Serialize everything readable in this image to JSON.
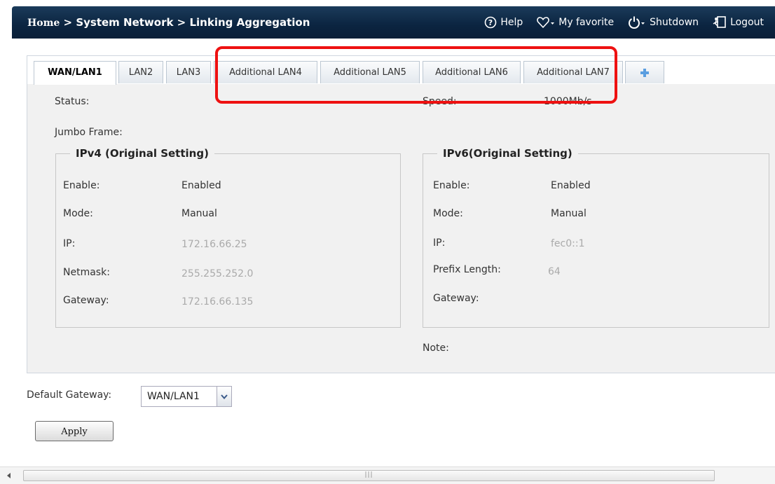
{
  "header": {
    "breadcrumb_home": "Home",
    "breadcrumb_sep1": " > ",
    "breadcrumb_mid": "System Network",
    "breadcrumb_sep2": " > ",
    "breadcrumb_page": "Linking Aggregation",
    "help": "Help",
    "favorite": "My favorite",
    "shutdown": "Shutdown",
    "logout": "Logout"
  },
  "tabs": [
    "WAN/LAN1",
    "LAN2",
    "LAN3",
    "Additional LAN4",
    "Additional LAN5",
    "Additional LAN6",
    "Additional LAN7"
  ],
  "status_label": "Status:",
  "speed_label": "Speed:",
  "speed_value": "1000Mb/s",
  "jumbo_label": "Jumbo Frame:",
  "ipv4": {
    "legend": "IPv4 (Original Setting)",
    "enable_label": "Enable:",
    "enable_value": "Enabled",
    "mode_label": "Mode:",
    "mode_value": "Manual",
    "ip_label": "IP:",
    "ip_value": "172.16.66.25",
    "netmask_label": "Netmask:",
    "netmask_value": "255.255.252.0",
    "gateway_label": "Gateway:",
    "gateway_value": "172.16.66.135"
  },
  "ipv6": {
    "legend": "IPv6(Original Setting)",
    "enable_label": "Enable:",
    "enable_value": "Enabled",
    "mode_label": "Mode:",
    "mode_value": "Manual",
    "ip_label": "IP:",
    "ip_value": "fec0::1",
    "prefix_label": "Prefix Length:",
    "prefix_value": "64",
    "gateway_label": "Gateway:"
  },
  "note_label": "Note:",
  "default_gateway": {
    "label": "Default Gateway:",
    "value": "WAN/LAN1"
  },
  "apply_label": "Apply",
  "colors": {
    "header_bg": "#0b2440",
    "highlight": "#e11111",
    "panel_bg": "#f1f1f1"
  },
  "icons": [
    "help-icon",
    "heart-icon",
    "power-icon",
    "logout-icon",
    "add-tab-icon",
    "dropdown-arrow-icon",
    "scroll-left-icon"
  ]
}
